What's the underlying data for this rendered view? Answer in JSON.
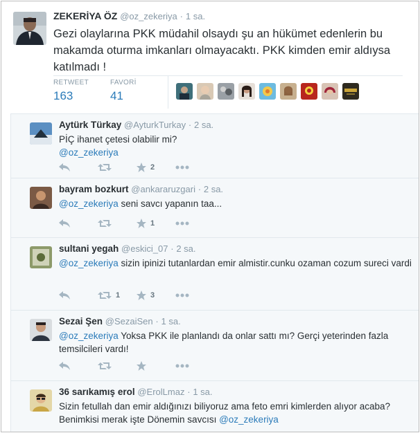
{
  "main_tweet": {
    "name": "ZEKERİYA ÖZ",
    "handle": "@oz_zekeriya",
    "time": "1 sa.",
    "text": "Gezi olaylarına PKK müdahil olsaydı şu an hükümet edenlerin bu makamda oturma imkanları olmayacaktı. PKK kimden emir aldıysa katılmadı !",
    "retweet_label": "RETWEET",
    "retweet_count": "163",
    "favorite_label": "FAVORİ",
    "favorite_count": "41"
  },
  "replies": [
    {
      "name": "Aytürk Türkay",
      "handle": "@AyturkTurkay",
      "time": "2 sa.",
      "text_before": "PİÇ ihanet çetesi olabilir mi?",
      "mention": "@oz_zekeriya",
      "text_after": "",
      "retweets": "",
      "favorites": "2"
    },
    {
      "name": "bayram bozkurt",
      "handle": "@ankararuzgari",
      "time": "2 sa.",
      "text_before": "",
      "mention": "@oz_zekeriya",
      "text_after": " seni savcı yapanın taa...",
      "retweets": "",
      "favorites": "1"
    },
    {
      "name": "sultani yegah",
      "handle": "@eskici_07",
      "time": "2 sa.",
      "text_before": "",
      "mention": "@oz_zekeriya",
      "text_after": " sizin ipinizi tutanlardan emir almistir.cunku ozaman cozum sureci vardi",
      "retweets": "1",
      "favorites": "3"
    },
    {
      "name": "Sezai Şen",
      "handle": "@SezaiSen",
      "time": "1 sa.",
      "text_before": "",
      "mention": "@oz_zekeriya",
      "text_after": " Yoksa PKK ile planlandı da onlar sattı mı? Gerçi yeterinden fazla temsilcileri vardı!",
      "retweets": "",
      "favorites": ""
    },
    {
      "name": "36 sarıkamış erol",
      "handle": "@ErolLmaz",
      "time": "1 sa.",
      "text_before": "Sizin fetullah dan emir aldığınızı biliyoruz ama feto emri kimlerden alıyor acaba? Benimkisi merak işte Dönemin savcısı ",
      "mention": "@oz_zekeriya",
      "text_after": "",
      "retweets": "",
      "favorites": ""
    }
  ],
  "colors": {
    "link": "#2b7bb9",
    "meta": "#8899a6",
    "action_icon": "#a5b6c2",
    "reply_background": "#f5f8fa"
  },
  "icons": [
    "reply-icon",
    "retweet-icon",
    "favorite-star-icon",
    "more-icon"
  ]
}
